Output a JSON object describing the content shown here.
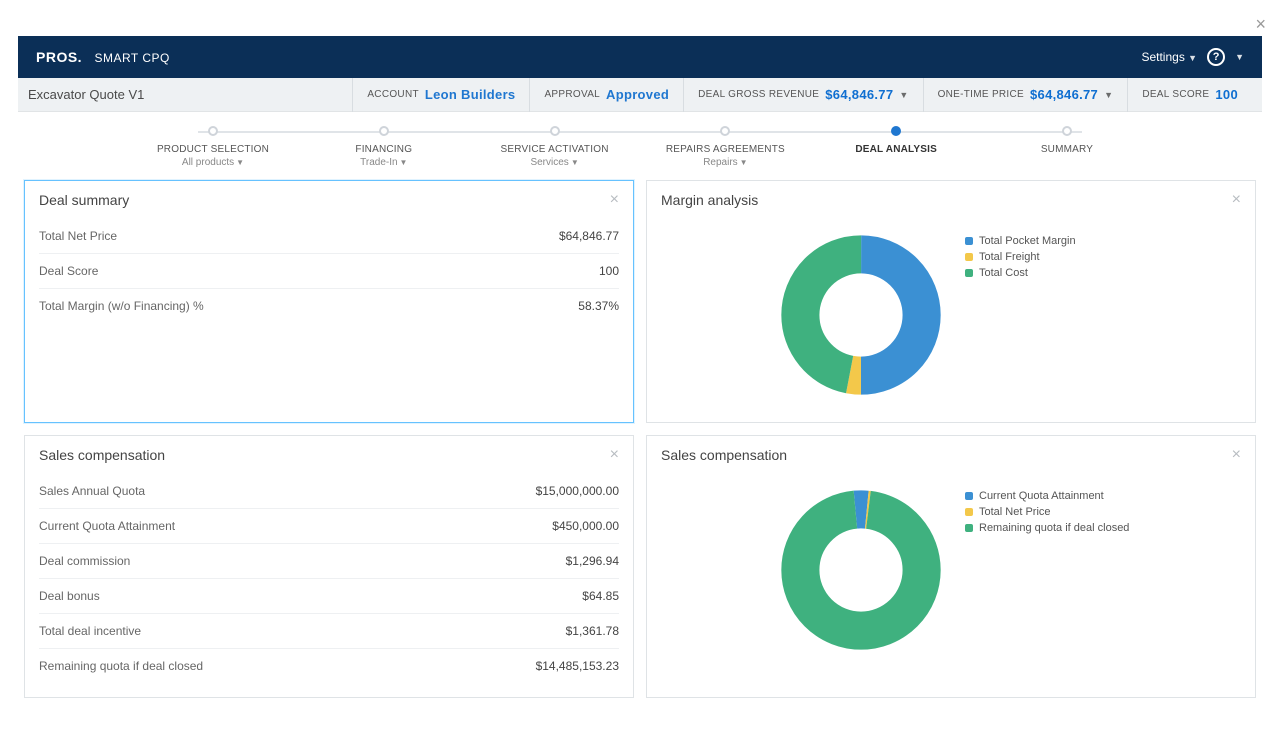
{
  "header": {
    "brand": "PROS.",
    "product": "SMART CPQ",
    "settings_label": "Settings"
  },
  "quote": {
    "name": "Excavator Quote V1",
    "account_label": "ACCOUNT",
    "account_value": "Leon Builders",
    "approval_label": "APPROVAL",
    "approval_value": "Approved",
    "gross_rev_label": "DEAL GROSS REVENUE",
    "gross_rev_value": "$64,846.77",
    "one_time_label": "ONE-TIME PRICE",
    "one_time_value": "$64,846.77",
    "score_label": "DEAL SCORE",
    "score_value": "100"
  },
  "steps": [
    {
      "title": "PRODUCT SELECTION",
      "sub": "All products",
      "has_sub": true,
      "active": false
    },
    {
      "title": "FINANCING",
      "sub": "Trade-In",
      "has_sub": true,
      "active": false
    },
    {
      "title": "SERVICE ACTIVATION",
      "sub": "Services",
      "has_sub": true,
      "active": false
    },
    {
      "title": "REPAIRS AGREEMENTS",
      "sub": "Repairs",
      "has_sub": true,
      "active": false
    },
    {
      "title": "DEAL ANALYSIS",
      "sub": "",
      "has_sub": false,
      "active": true
    },
    {
      "title": "SUMMARY",
      "sub": "",
      "has_sub": false,
      "active": false
    }
  ],
  "panels": {
    "deal_summary": {
      "title": "Deal summary",
      "rows": [
        {
          "label": "Total Net Price",
          "value": "$64,846.77"
        },
        {
          "label": "Deal Score",
          "value": "100"
        },
        {
          "label": "Total Margin (w/o Financing) %",
          "value": "58.37%"
        }
      ]
    },
    "margin_analysis": {
      "title": "Margin analysis",
      "legend": [
        {
          "label": "Total Pocket Margin",
          "color": "#3b90d3"
        },
        {
          "label": "Total Freight",
          "color": "#f3c84a"
        },
        {
          "label": "Total Cost",
          "color": "#3fb17f"
        }
      ]
    },
    "sales_comp_left": {
      "title": "Sales compensation",
      "rows": [
        {
          "label": "Sales Annual Quota",
          "value": "$15,000,000.00"
        },
        {
          "label": "Current Quota Attainment",
          "value": "$450,000.00"
        },
        {
          "label": "Deal commission",
          "value": "$1,296.94"
        },
        {
          "label": "Deal bonus",
          "value": "$64.85"
        },
        {
          "label": "Total deal incentive",
          "value": "$1,361.78"
        },
        {
          "label": "Remaining quota if deal closed",
          "value": "$14,485,153.23"
        }
      ]
    },
    "sales_comp_right": {
      "title": "Sales compensation",
      "legend": [
        {
          "label": "Current Quota Attainment",
          "color": "#3b90d3"
        },
        {
          "label": "Total Net Price",
          "color": "#f3c84a"
        },
        {
          "label": "Remaining quota if deal closed",
          "color": "#3fb17f"
        }
      ]
    }
  },
  "colors": {
    "blue": "#3b90d3",
    "green": "#3fb17f",
    "yellow": "#f3c84a",
    "navy": "#0b2f57"
  },
  "chart_data": [
    {
      "type": "pie",
      "title": "Margin analysis",
      "series": [
        {
          "name": "Margin",
          "values": [
            50,
            3,
            47
          ]
        }
      ],
      "categories": [
        "Total Pocket Margin",
        "Total Freight",
        "Total Cost"
      ],
      "colors": [
        "#3b90d3",
        "#f3c84a",
        "#3fb17f"
      ],
      "donut_inner_pct": 55
    },
    {
      "type": "pie",
      "title": "Sales compensation",
      "series": [
        {
          "name": "Quota",
          "values": [
            3.0,
            0.43,
            96.57
          ]
        }
      ],
      "categories": [
        "Current Quota Attainment",
        "Total Net Price",
        "Remaining quota if deal closed"
      ],
      "colors": [
        "#3b90d3",
        "#f3c84a",
        "#3fb17f"
      ],
      "donut_inner_pct": 55
    }
  ]
}
